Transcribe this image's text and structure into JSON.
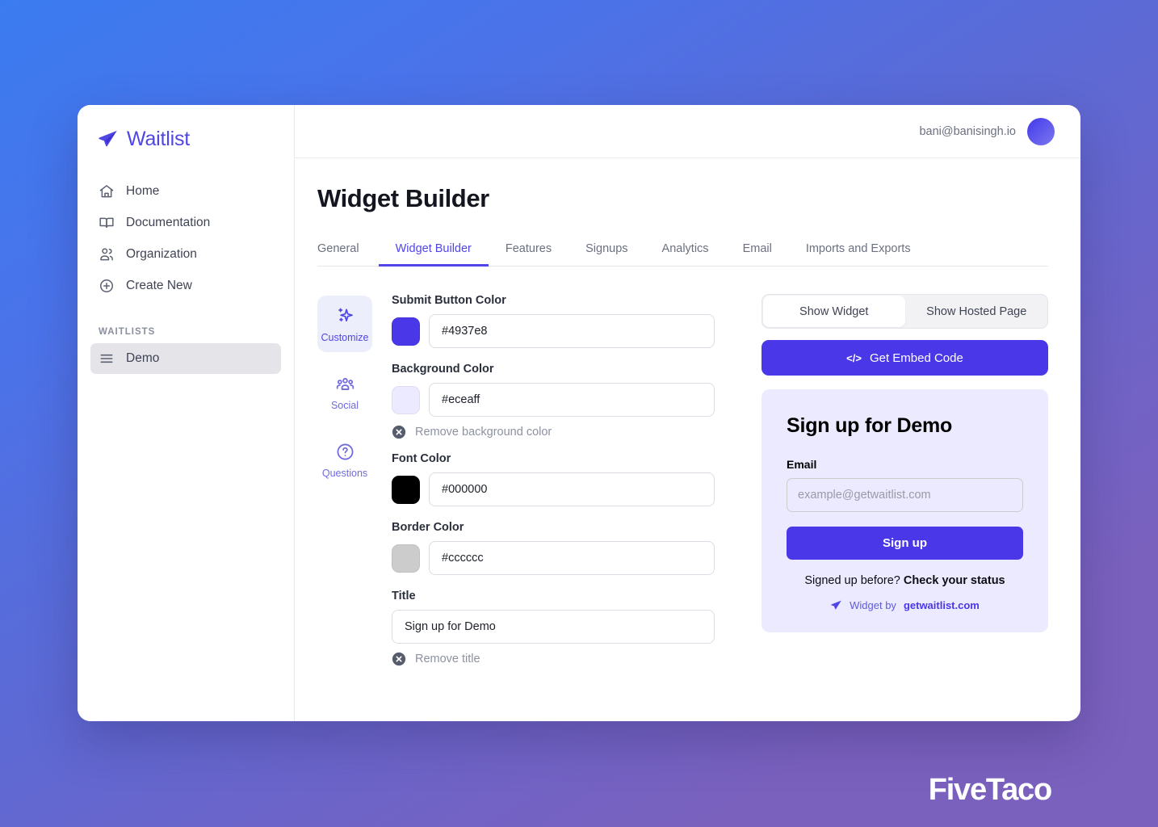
{
  "brand": {
    "name": "Waitlist",
    "logo_icon": "paper-plane-icon",
    "accent": "#4f46e5"
  },
  "sidebar": {
    "items": [
      {
        "label": "Home",
        "icon": "home-icon"
      },
      {
        "label": "Documentation",
        "icon": "book-icon"
      },
      {
        "label": "Organization",
        "icon": "users-icon"
      },
      {
        "label": "Create New",
        "icon": "plus-circle-icon"
      }
    ],
    "section_label": "WAITLISTS",
    "waitlists": [
      {
        "label": "Demo",
        "icon": "list-icon",
        "selected": true
      }
    ]
  },
  "topbar": {
    "user_email": "bani@banisingh.io",
    "avatar_icon": "avatar"
  },
  "page": {
    "title": "Widget Builder"
  },
  "tabs": [
    {
      "label": "General",
      "active": false
    },
    {
      "label": "Widget Builder",
      "active": true
    },
    {
      "label": "Features",
      "active": false
    },
    {
      "label": "Signups",
      "active": false
    },
    {
      "label": "Analytics",
      "active": false
    },
    {
      "label": "Email",
      "active": false
    },
    {
      "label": "Imports and Exports",
      "active": false
    }
  ],
  "side_icons": [
    {
      "label": "Customize",
      "icon": "sparkles-icon",
      "active": true
    },
    {
      "label": "Social",
      "icon": "people-icon",
      "active": false
    },
    {
      "label": "Questions",
      "icon": "question-circle-icon",
      "active": false
    }
  ],
  "form": {
    "submit_button_color": {
      "label": "Submit Button Color",
      "value": "#4937e8",
      "swatch": "#4937e8"
    },
    "background_color": {
      "label": "Background Color",
      "value": "#eceaff",
      "swatch": "#eceaff",
      "remove_label": "Remove background color",
      "remove_icon": "x-circle-icon"
    },
    "font_color": {
      "label": "Font Color",
      "value": "#000000",
      "swatch": "#000000"
    },
    "border_color": {
      "label": "Border Color",
      "value": "#cccccc",
      "swatch": "#cccccc"
    },
    "title": {
      "label": "Title",
      "value": "Sign up for Demo",
      "remove_label": "Remove title",
      "remove_icon": "x-circle-icon"
    }
  },
  "preview": {
    "segment": {
      "show_widget": "Show Widget",
      "show_hosted_page": "Show Hosted Page",
      "active": "Show Widget"
    },
    "embed_button": {
      "label": "Get Embed Code",
      "icon": "code-icon",
      "color": "#4937e8"
    },
    "widget": {
      "background": "#eceaff",
      "title": "Sign up for Demo",
      "email_label": "Email",
      "email_placeholder": "example@getwaitlist.com",
      "email_value": "",
      "signup_button": "Sign up",
      "status_prefix": "Signed up before?",
      "status_link": "Check your status",
      "credit_prefix": "Widget by",
      "credit_link": "getwaitlist.com",
      "credit_icon": "paper-plane-icon"
    }
  },
  "watermark": {
    "text": "FiveTaco"
  }
}
